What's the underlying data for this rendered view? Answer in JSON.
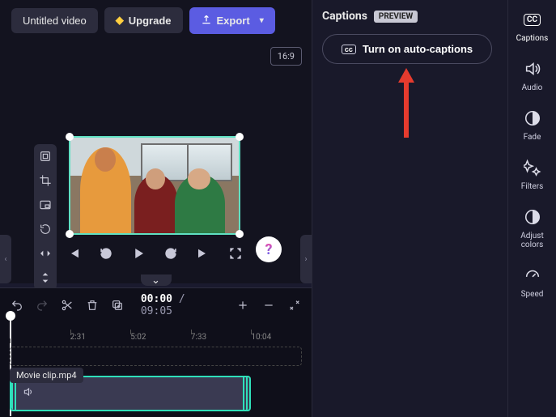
{
  "header": {
    "title": "Untitled video",
    "upgrade": "Upgrade",
    "export": "Export"
  },
  "editor": {
    "aspect_ratio": "16:9",
    "playback": {
      "current": "00:00",
      "duration": "09:05"
    }
  },
  "timeline": {
    "ticks": [
      "2:31",
      "5:02",
      "7:33",
      "10:04"
    ],
    "clip_name": "Movie clip.mp4"
  },
  "captions_panel": {
    "title": "Captions",
    "badge": "PREVIEW",
    "auto_btn": "Turn on auto-captions"
  },
  "sidebar": {
    "items": [
      {
        "id": "captions",
        "label": "Captions"
      },
      {
        "id": "audio",
        "label": "Audio"
      },
      {
        "id": "fade",
        "label": "Fade"
      },
      {
        "id": "filters",
        "label": "Filters"
      },
      {
        "id": "adjust",
        "label": "Adjust colors"
      },
      {
        "id": "speed",
        "label": "Speed"
      }
    ]
  }
}
